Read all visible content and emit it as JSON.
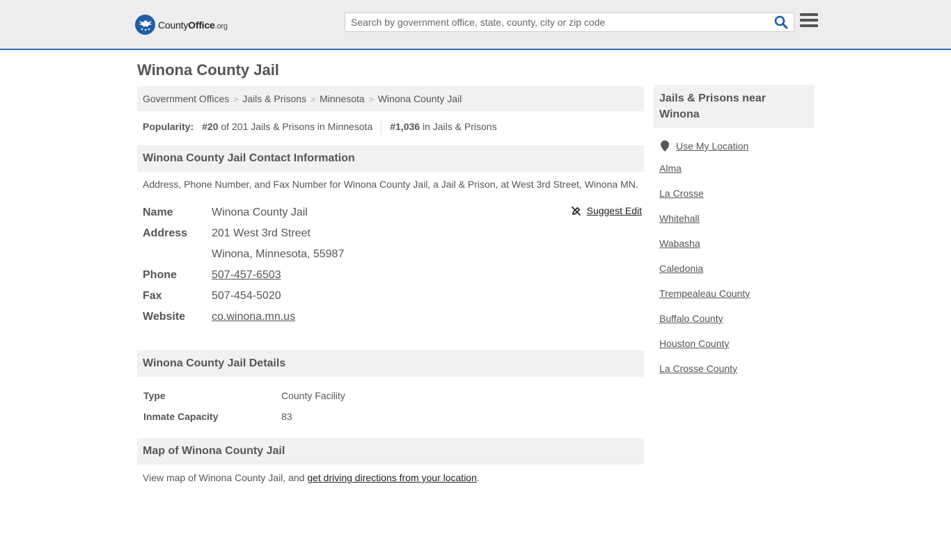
{
  "header": {
    "logo": {
      "name_part1": "County",
      "name_part2": "Office",
      "tld": ".org"
    },
    "search": {
      "placeholder": "Search by government office, state, county, city or zip code",
      "value": ""
    },
    "accent_color": "#2b6cb0"
  },
  "page": {
    "title": "Winona County Jail"
  },
  "breadcrumb": [
    {
      "label": "Government Offices"
    },
    {
      "label": "Jails & Prisons"
    },
    {
      "label": "Minnesota"
    },
    {
      "label": "Winona County Jail"
    }
  ],
  "popularity": {
    "label": "Popularity:",
    "state_rank": "#20",
    "state_rank_text": "of 201 Jails & Prisons in Minnesota",
    "national_rank": "#1,036",
    "national_rank_text": "in Jails & Prisons"
  },
  "contact": {
    "heading": "Winona County Jail Contact Information",
    "description": "Address, Phone Number, and Fax Number for Winona County Jail, a Jail & Prison, at West 3rd Street, Winona MN.",
    "suggest_edit": "Suggest Edit",
    "rows": {
      "name": {
        "label": "Name",
        "value": "Winona County Jail"
      },
      "address": {
        "label": "Address",
        "line1": "201 West 3rd Street",
        "line2": "Winona, Minnesota, 55987"
      },
      "phone": {
        "label": "Phone",
        "value": "507-457-6503"
      },
      "fax": {
        "label": "Fax",
        "value": "507-454-5020"
      },
      "website": {
        "label": "Website",
        "value": "co.winona.mn.us"
      }
    }
  },
  "details": {
    "heading": "Winona County Jail Details",
    "rows": [
      {
        "label": "Type",
        "value": "County Facility"
      },
      {
        "label": "Inmate Capacity",
        "value": "83"
      }
    ]
  },
  "map": {
    "heading": "Map of Winona County Jail",
    "text_before": "View map of Winona County Jail, and ",
    "link": "get driving directions from your location",
    "text_after": "."
  },
  "sidebar": {
    "heading": "Jails & Prisons near Winona",
    "use_location": "Use My Location",
    "links": [
      "Alma",
      "La Crosse",
      "Whitehall",
      "Wabasha",
      "Caledonia",
      "Trempealeau County",
      "Buffalo County",
      "Houston County",
      "La Crosse County"
    ]
  }
}
